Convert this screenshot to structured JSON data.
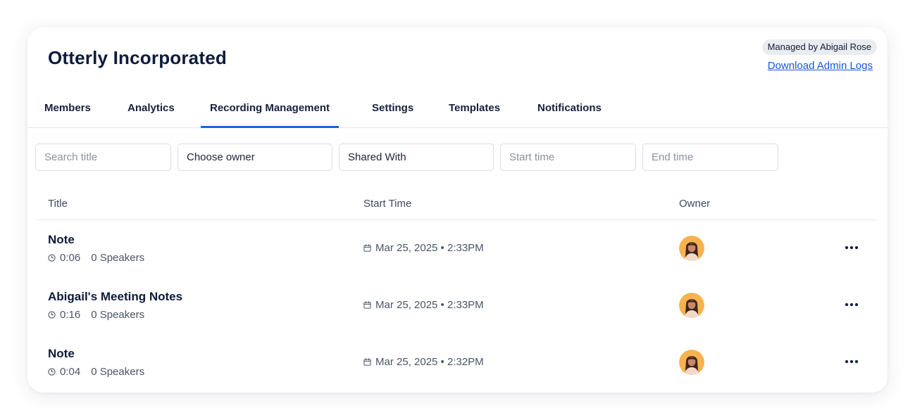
{
  "org": {
    "name": "Otterly Incorporated",
    "managed_by": "Managed by Abigail Rose",
    "admin_logs_link": "Download Admin Logs"
  },
  "tabs": [
    {
      "label": "Members",
      "active": false
    },
    {
      "label": "Analytics",
      "active": false
    },
    {
      "label": "Recording Management",
      "active": true
    },
    {
      "label": "Settings",
      "active": false
    },
    {
      "label": "Templates",
      "active": false
    },
    {
      "label": "Notifications",
      "active": false
    }
  ],
  "filters": {
    "search_title": {
      "placeholder": "Search title"
    },
    "owner": {
      "value": "Choose owner"
    },
    "shared_with": {
      "value": "Shared With"
    },
    "start_time": {
      "placeholder": "Start time"
    },
    "end_time": {
      "placeholder": "End time"
    }
  },
  "table": {
    "columns": [
      "Title",
      "Start Time",
      "Owner"
    ],
    "rows": [
      {
        "title": "Note",
        "duration": "0:06",
        "speakers": "0 Speakers",
        "start": "Mar 25, 2025 • 2:33PM"
      },
      {
        "title": "Abigail's Meeting Notes",
        "duration": "0:16",
        "speakers": "0 Speakers",
        "start": "Mar 25, 2025 • 2:33PM"
      },
      {
        "title": "Note",
        "duration": "0:04",
        "speakers": "0 Speakers",
        "start": "Mar 25, 2025 • 2:32PM"
      }
    ]
  },
  "icons": {
    "duration": "clock-icon",
    "start": "calendar-icon",
    "owner": "owner-avatar",
    "actions": "more-options-icon"
  },
  "colors": {
    "accent": "#1e63d6",
    "link": "#1558d6",
    "heading": "#0e1b3d",
    "avatar_bg": "#f6b24f"
  }
}
